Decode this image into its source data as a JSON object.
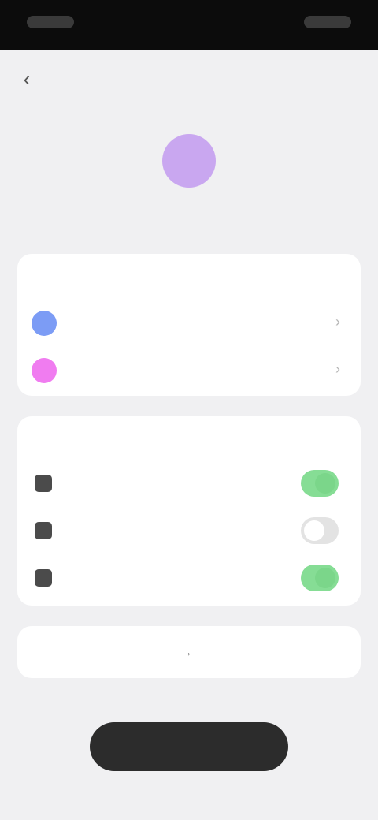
{
  "colors": {
    "status_bar": "#0c0c0c",
    "background": "#f0f0f2",
    "avatar": "#c9a7f0",
    "profile_name": "#9a6ad8",
    "account_1_dot": "#7c9cf5",
    "account_2_dot": "#f07cf0",
    "toggle_on": "#86dd95",
    "toggle_off": "#e3e3e3",
    "bottom_button": "#2c2c2c"
  },
  "header": {
    "back_icon": "chevron-left-icon"
  },
  "profile": {
    "avatar_icon": "user-avatar-icon",
    "name": ""
  },
  "accounts": {
    "title": "",
    "items": [
      {
        "label": "",
        "dot_color": "#7c9cf5"
      },
      {
        "label": "",
        "dot_color": "#f07cf0"
      }
    ]
  },
  "notifications": {
    "title": "",
    "items": [
      {
        "label": "",
        "on": true
      },
      {
        "label": "",
        "on": false
      },
      {
        "label": "",
        "on": true
      }
    ]
  },
  "link_row": {
    "label": ""
  },
  "bottom_button": {
    "label": ""
  }
}
